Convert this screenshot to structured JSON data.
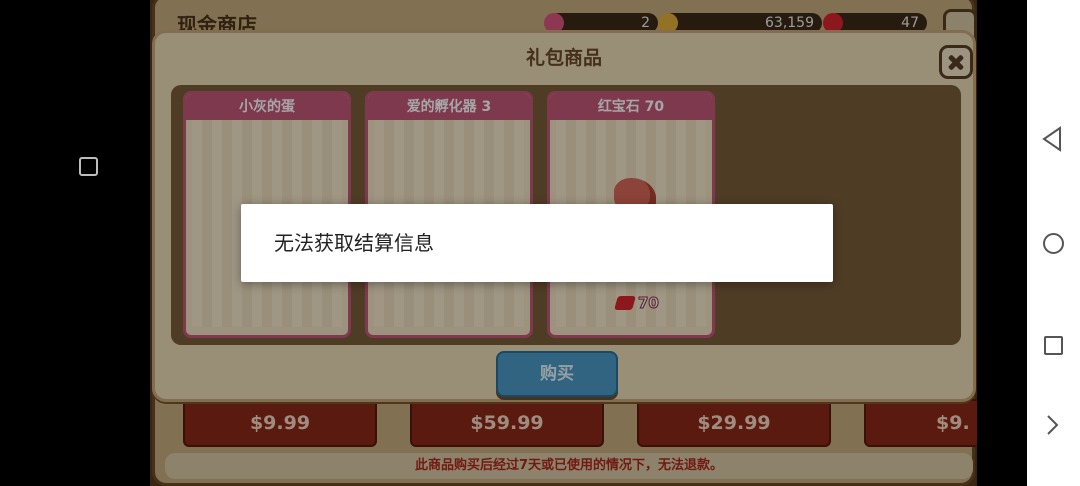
{
  "background_shop": {
    "title": "现金商店",
    "currency": [
      "2",
      "63,159",
      "47"
    ],
    "prices": [
      "$9.99",
      "$59.99",
      "$29.99",
      "$9."
    ],
    "footer_note": "此商品购买后经过7天或已使用的情况下，无法退款。"
  },
  "gift_dialog": {
    "title": "礼包商品",
    "items": [
      {
        "name": "小灰的蛋",
        "price": ""
      },
      {
        "name": "爱的孵化器 3",
        "price": ""
      },
      {
        "name": "红宝石 70",
        "price": "70"
      }
    ],
    "buy_label": "购买"
  },
  "toast": {
    "message": "无法获取结算信息"
  },
  "icons": {
    "close": "close-icon",
    "ruby": "ruby-icon",
    "nav_back": "back-icon",
    "nav_home": "home-icon",
    "nav_recents": "recents-icon",
    "nav_expand": "chevron-right-icon"
  },
  "colors": {
    "card_header": "#c4587a",
    "buy_button": "#4b9ac6",
    "price_button": "#8b2818"
  }
}
